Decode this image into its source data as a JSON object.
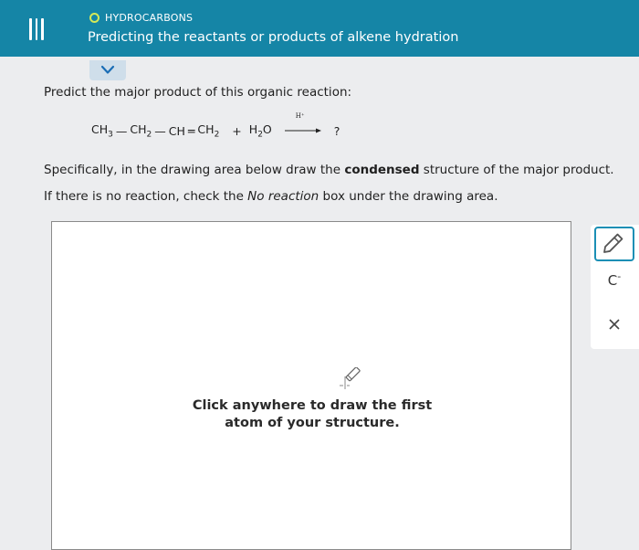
{
  "header": {
    "menu_icon": "hamburger-menu-icon",
    "topic": "HYDROCARBONS",
    "topic_status_color": "#d4e858",
    "title": "Predicting the reactants or products of alkene hydration",
    "background_color": "#1585a6"
  },
  "question": {
    "prompt": "Predict the major product of this organic reaction:",
    "reaction": {
      "reactant1": {
        "ch3": "CH",
        "ch3_sub": "3",
        "bond1": "—",
        "ch2": "CH",
        "ch2_sub": "2",
        "bond2": "—",
        "ch": "CH",
        "bond3": "═",
        "ch2b": "CH",
        "ch2b_sub": "2"
      },
      "plus": "+",
      "reactant2": {
        "h": "H",
        "h_sub": "2",
        "o": "O"
      },
      "catalyst": "H⁺",
      "product": "?"
    },
    "instruction1_pre": "Specifically, in the drawing area below draw the ",
    "instruction1_bold": "condensed",
    "instruction1_post": " structure of the major product.",
    "instruction2_pre": "If there is no reaction, check the ",
    "instruction2_italic": "No reaction",
    "instruction2_post": " box under the drawing area."
  },
  "drawing": {
    "hint_line1": "Click anywhere to draw the first",
    "hint_line2": "atom of your structure.",
    "hint_icon": "pencil-cursor-icon"
  },
  "toolbar": {
    "pencil": "pencil-icon",
    "charge_letter": "C",
    "charge_sign": "-",
    "close": "close-icon",
    "accent_color": "#1b8fb5"
  }
}
